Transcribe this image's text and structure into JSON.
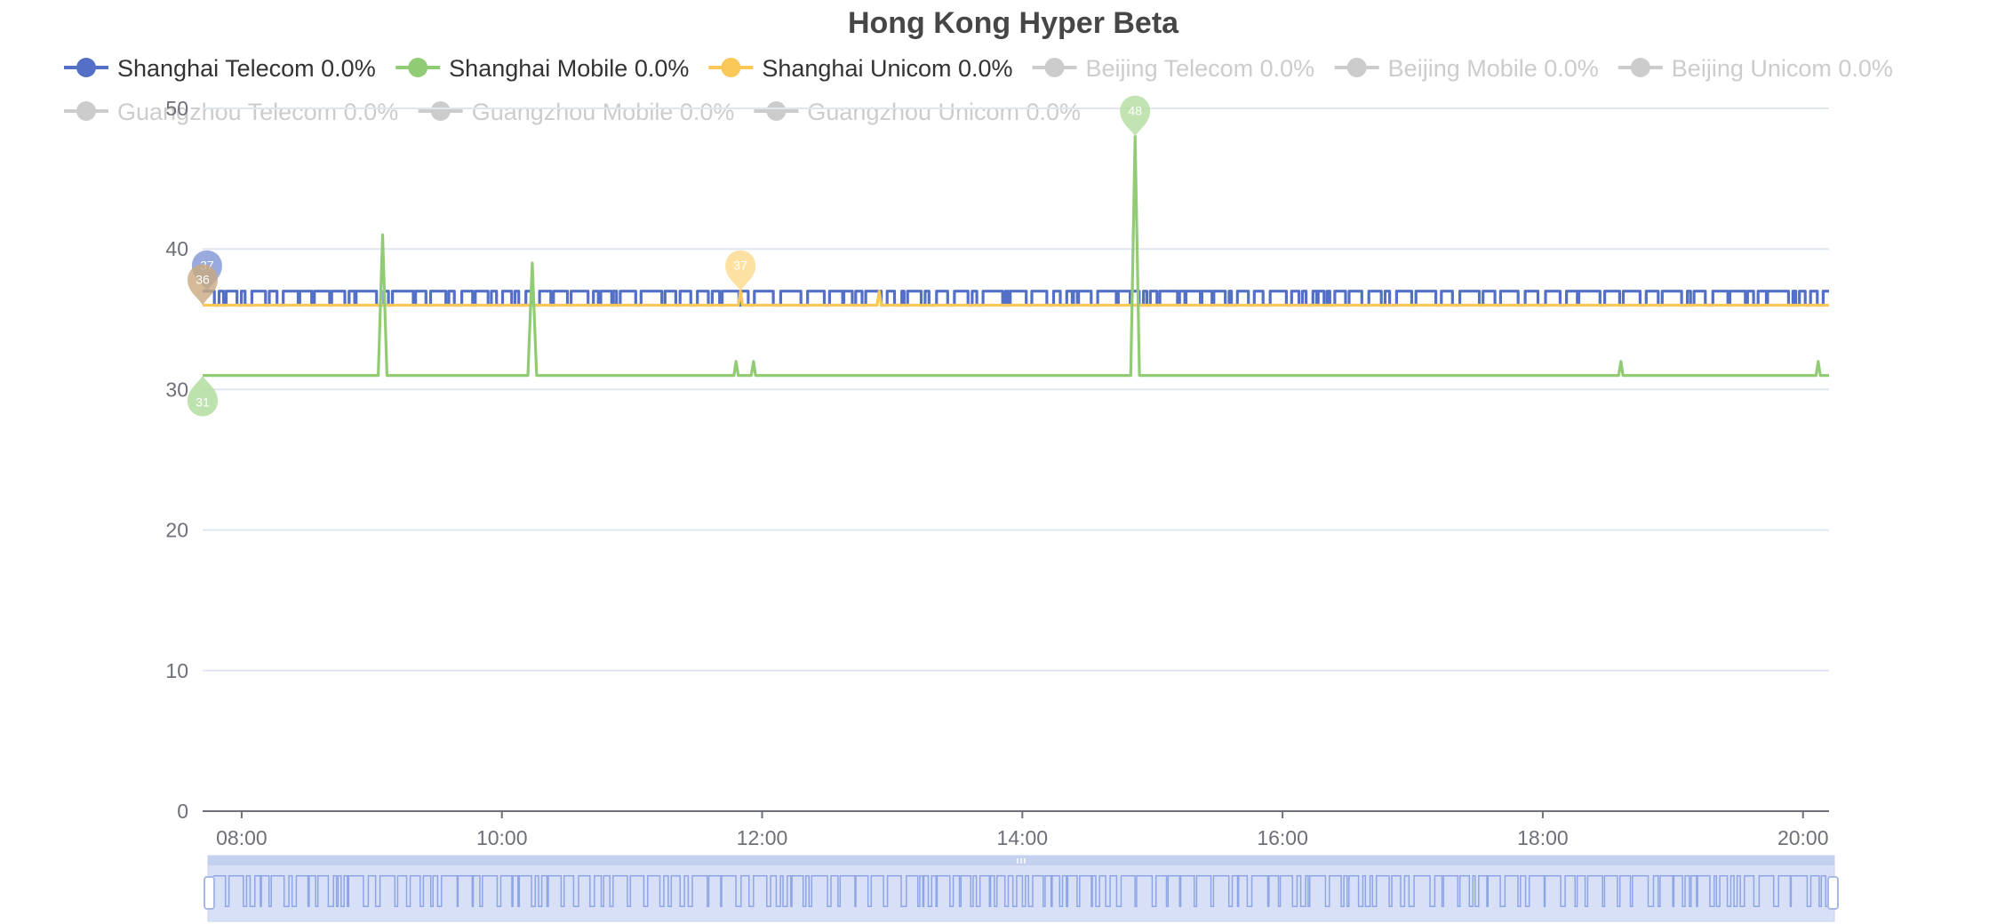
{
  "chart_data": {
    "type": "line",
    "title": "Hong Kong  Hyper Beta",
    "xlabel": "",
    "ylabel": "",
    "x_range": [
      "07:42",
      "20:12"
    ],
    "x_ticks": [
      "08:00",
      "10:00",
      "12:00",
      "14:00",
      "16:00",
      "18:00",
      "20:00"
    ],
    "ylim": [
      0,
      50
    ],
    "y_ticks": [
      0,
      10,
      20,
      30,
      40,
      50
    ],
    "grid": "horizontal",
    "legend_position": "top",
    "series": [
      {
        "name": "Shanghai Telecom 0.0%",
        "color": "#5470c6",
        "active": true,
        "baseline": 36,
        "spike_level": 37,
        "note": "oscillates between 36 and 37 throughout",
        "points": [
          [
            "07:42",
            36
          ],
          [
            "07:45",
            37
          ],
          [
            "08:00",
            36
          ],
          [
            "08:05",
            37
          ],
          [
            "20:12",
            37
          ]
        ],
        "markers": [
          {
            "label": "37",
            "x": "07:44",
            "y": 37,
            "kind": "max"
          }
        ]
      },
      {
        "name": "Shanghai Mobile 0.0%",
        "color": "#91cc75",
        "active": true,
        "points": [
          [
            "07:42",
            31
          ],
          [
            "09:03",
            31
          ],
          [
            "09:05",
            41
          ],
          [
            "09:07",
            31
          ],
          [
            "10:12",
            31
          ],
          [
            "10:14",
            39
          ],
          [
            "10:16",
            31
          ],
          [
            "11:47",
            31
          ],
          [
            "11:48",
            32
          ],
          [
            "11:49",
            31
          ],
          [
            "11:55",
            31
          ],
          [
            "11:56",
            32
          ],
          [
            "11:57",
            31
          ],
          [
            "14:50",
            31
          ],
          [
            "14:52",
            48
          ],
          [
            "14:54",
            31
          ],
          [
            "18:35",
            31
          ],
          [
            "18:36",
            32
          ],
          [
            "18:37",
            31
          ],
          [
            "20:06",
            31
          ],
          [
            "20:07",
            32
          ],
          [
            "20:08",
            31
          ],
          [
            "20:12",
            31
          ]
        ],
        "markers": [
          {
            "label": "48",
            "x": "14:52",
            "y": 48,
            "kind": "max"
          },
          {
            "label": "31",
            "x": "07:42",
            "y": 31,
            "kind": "min"
          }
        ]
      },
      {
        "name": "Shanghai Unicom 0.0%",
        "color": "#fac858",
        "active": true,
        "points": [
          [
            "07:42",
            36
          ],
          [
            "11:49",
            36
          ],
          [
            "11:50",
            37
          ],
          [
            "11:51",
            36
          ],
          [
            "12:53",
            36
          ],
          [
            "12:54",
            37
          ],
          [
            "12:55",
            36
          ],
          [
            "20:12",
            36
          ]
        ],
        "markers": [
          {
            "label": "37",
            "x": "11:50",
            "y": 37,
            "kind": "max"
          },
          {
            "label": "36",
            "x": "07:42",
            "y": 36,
            "kind": "min"
          }
        ]
      },
      {
        "name": "Beijing Telecom 0.0%",
        "color": "#cccccc",
        "active": false
      },
      {
        "name": "Beijing Mobile 0.0%",
        "color": "#cccccc",
        "active": false
      },
      {
        "name": "Beijing Unicom 0.0%",
        "color": "#cccccc",
        "active": false
      },
      {
        "name": "Guangzhou Telecom 0.0%",
        "color": "#cccccc",
        "active": false
      },
      {
        "name": "Guangzhou Mobile 0.0%",
        "color": "#cccccc",
        "active": false
      },
      {
        "name": "Guangzhou Unicom 0.0%",
        "color": "#cccccc",
        "active": false
      }
    ],
    "markers_colors": {
      "max": "#9aaee0",
      "min_shanghai_unicom": "#c9a97f"
    },
    "data_zoom": {
      "start": 0,
      "end": 100
    }
  }
}
